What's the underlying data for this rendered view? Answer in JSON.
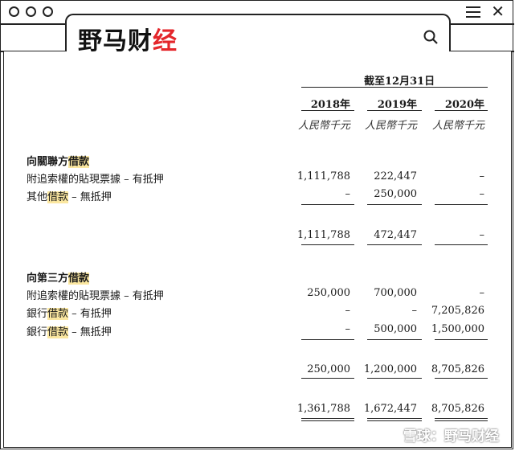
{
  "window": {
    "logo_text_a": "野马财",
    "logo_text_b": "经",
    "brand_color": "#e4262b",
    "icons": [
      "circle-icon",
      "circle-icon",
      "circle-icon",
      "menu-icon",
      "close-icon",
      "search-icon"
    ]
  },
  "table": {
    "period_header": "截至12月31日",
    "years": [
      "2018年",
      "2019年",
      "2020年"
    ],
    "units": [
      "人民幣千元",
      "人民幣千元",
      "人民幣千元"
    ],
    "section1": {
      "title_prefix": "向關聯方",
      "title_hl": "借款",
      "rows": [
        {
          "label_a": "附追索權的貼現票據 – 有抵押",
          "label_hl": "",
          "label_b": "",
          "values": [
            "1,111,788",
            "222,447",
            "–"
          ]
        },
        {
          "label_a": "其他",
          "label_hl": "借款",
          "label_b": " – 無抵押",
          "values": [
            "–",
            "250,000",
            "–"
          ]
        }
      ],
      "subtotal": [
        "1,111,788",
        "472,447",
        "–"
      ]
    },
    "section2": {
      "title_prefix": "向第三方",
      "title_hl": "借款",
      "rows": [
        {
          "label_a": "附追索權的貼現票據 – 有抵押",
          "label_hl": "",
          "label_b": "",
          "values": [
            "250,000",
            "700,000",
            "–"
          ]
        },
        {
          "label_a": "銀行",
          "label_hl": "借款",
          "label_b": " – 有抵押",
          "values": [
            "–",
            "–",
            "7,205,826"
          ]
        },
        {
          "label_a": "銀行",
          "label_hl": "借款",
          "label_b": " – 無抵押",
          "values": [
            "–",
            "500,000",
            "1,500,000"
          ]
        }
      ],
      "subtotal": [
        "250,000",
        "1,200,000",
        "8,705,826"
      ]
    },
    "total": [
      "1,361,788",
      "1,672,447",
      "8,705,826"
    ]
  },
  "watermark": "雪球：野马财经",
  "highlight_color": "#fbe7a0"
}
